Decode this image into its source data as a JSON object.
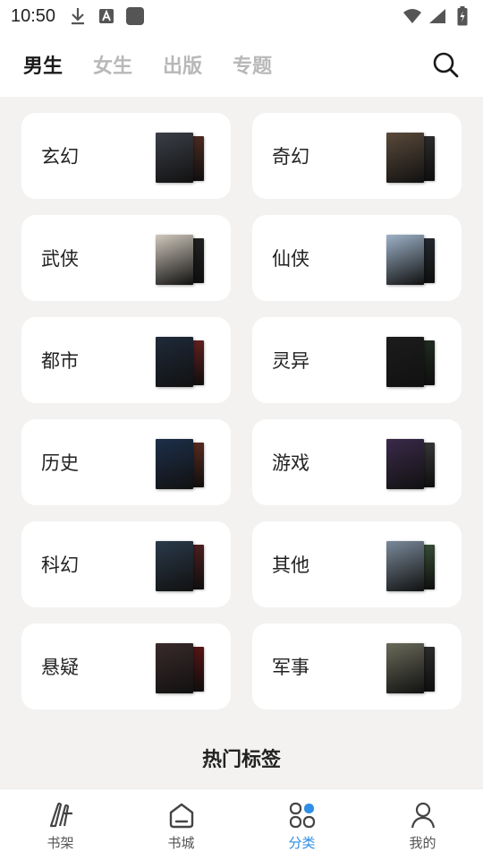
{
  "status_bar": {
    "time": "10:50",
    "icons_left": [
      "download-icon",
      "font-a-icon",
      "app-square-icon"
    ],
    "icons_right": [
      "wifi-icon",
      "signal-icon",
      "battery-charging-icon"
    ]
  },
  "header": {
    "tabs": [
      {
        "label": "男生",
        "active": true
      },
      {
        "label": "女生",
        "active": false
      },
      {
        "label": "出版",
        "active": false
      },
      {
        "label": "专题",
        "active": false
      }
    ],
    "search_icon": "search-icon"
  },
  "categories": [
    {
      "label": "玄幻",
      "cover_front": "#3b3f47",
      "cover_back": "#6a3a2e"
    },
    {
      "label": "奇幻",
      "cover_front": "#5a4a3a",
      "cover_back": "#3a3a3a"
    },
    {
      "label": "武侠",
      "cover_front": "#cfc8bc",
      "cover_back": "#2b2b2b"
    },
    {
      "label": "仙侠",
      "cover_front": "#9db2c8",
      "cover_back": "#2f3640"
    },
    {
      "label": "都市",
      "cover_front": "#1f2a3a",
      "cover_back": "#8a2a2a"
    },
    {
      "label": "灵异",
      "cover_front": "#1c1c1c",
      "cover_back": "#2c3a2c"
    },
    {
      "label": "历史",
      "cover_front": "#1d2f4a",
      "cover_back": "#7a3a2a"
    },
    {
      "label": "游戏",
      "cover_front": "#3a2a4a",
      "cover_back": "#4a4a4a"
    },
    {
      "label": "科幻",
      "cover_front": "#2a3a4a",
      "cover_back": "#6a2a2a"
    },
    {
      "label": "其他",
      "cover_front": "#7a8a9a",
      "cover_back": "#4a6a4a"
    },
    {
      "label": "悬疑",
      "cover_front": "#3a2a2a",
      "cover_back": "#7a1a1a"
    },
    {
      "label": "军事",
      "cover_front": "#6a6a5a",
      "cover_back": "#3a3a3a"
    }
  ],
  "section": {
    "title": "热门标签"
  },
  "bottom_nav": [
    {
      "label": "书架",
      "icon": "bookshelf-icon",
      "active": false
    },
    {
      "label": "书城",
      "icon": "bookstore-icon",
      "active": false
    },
    {
      "label": "分类",
      "icon": "category-icon",
      "active": true
    },
    {
      "label": "我的",
      "icon": "profile-icon",
      "active": false
    }
  ],
  "colors": {
    "accent": "#2f8ee5",
    "background": "#f3f2f1",
    "card": "#ffffff"
  }
}
